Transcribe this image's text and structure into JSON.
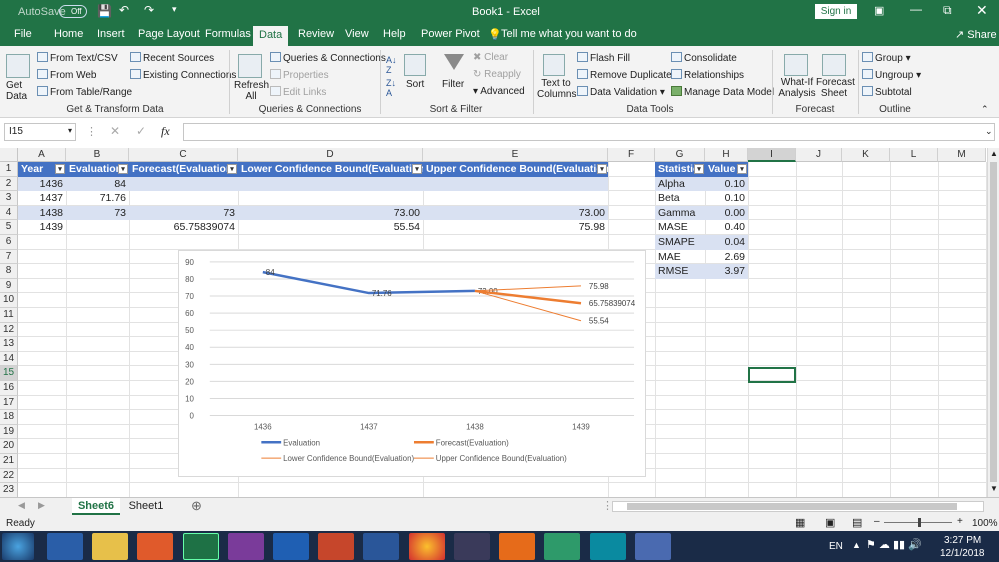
{
  "titlebar": {
    "autosave": "AutoSave",
    "autosave_state": "Off",
    "title": "Book1  -  Excel",
    "sign_in": "Sign in"
  },
  "ribbon_tabs": [
    "File",
    "Home",
    "Insert",
    "Page Layout",
    "Formulas",
    "Data",
    "Review",
    "View",
    "Help",
    "Power Pivot",
    "Tell me what you want to do"
  ],
  "share": "Share",
  "ribbon": {
    "get_data": "Get\nData",
    "from_text": "From Text/CSV",
    "from_web": "From Web",
    "from_table": "From Table/Range",
    "recent_sources": "Recent Sources",
    "existing_connections": "Existing Connections",
    "group_get_transform": "Get & Transform Data",
    "refresh_all": "Refresh All",
    "queries_connections": "Queries & Connections",
    "properties": "Properties",
    "edit_links": "Edit Links",
    "group_queries": "Queries & Connections",
    "sort": "Sort",
    "filter": "Filter",
    "clear": "Clear",
    "reapply": "Reapply",
    "advanced": "Advanced",
    "group_sort_filter": "Sort & Filter",
    "text_to_columns": "Text to Columns",
    "flash_fill": "Flash Fill",
    "remove_duplicates": "Remove Duplicates",
    "data_validation": "Data Validation",
    "consolidate": "Consolidate",
    "relationships": "Relationships",
    "manage_data_model": "Manage Data Model",
    "group_data_tools": "Data Tools",
    "what_if": "What-If Analysis",
    "forecast_sheet": "Forecast Sheet",
    "group_forecast": "Forecast",
    "group": "Group",
    "ungroup": "Ungroup",
    "subtotal": "Subtotal",
    "group_outline": "Outline"
  },
  "formula_bar": {
    "name_box": "I15",
    "fx": "fx",
    "value": ""
  },
  "columns": [
    "A",
    "B",
    "C",
    "D",
    "E",
    "F",
    "G",
    "H",
    "I",
    "J",
    "K",
    "L",
    "M"
  ],
  "rows": [
    "1",
    "2",
    "3",
    "4",
    "5",
    "6",
    "7",
    "8",
    "9",
    "10",
    "11",
    "12",
    "13",
    "14",
    "15",
    "16",
    "17",
    "18",
    "19",
    "20",
    "21",
    "22",
    "23"
  ],
  "table1": {
    "headers": [
      "Year",
      "Evaluation",
      "Forecast(Evaluation)",
      "Lower Confidence Bound(Evaluation)",
      "Upper Confidence Bound(Evaluation)"
    ],
    "rows": [
      [
        "1436",
        "84",
        "",
        "",
        ""
      ],
      [
        "1437",
        "71.76",
        "",
        "",
        ""
      ],
      [
        "1438",
        "73",
        "73",
        "73.00",
        "73.00"
      ],
      [
        "1439",
        "",
        "65.75839074",
        "55.54",
        "75.98"
      ]
    ]
  },
  "table2": {
    "headers": [
      "Statistic",
      "Value"
    ],
    "rows": [
      [
        "Alpha",
        "0.10"
      ],
      [
        "Beta",
        "0.10"
      ],
      [
        "Gamma",
        "0.00"
      ],
      [
        "MASE",
        "0.40"
      ],
      [
        "SMAPE",
        "0.04"
      ],
      [
        "MAE",
        "2.69"
      ],
      [
        "RMSE",
        "3.97"
      ]
    ]
  },
  "chart_data": {
    "type": "line",
    "categories": [
      "1436",
      "1437",
      "1438",
      "1439"
    ],
    "ylim": [
      0,
      90
    ],
    "yticks": [
      "0",
      "10",
      "20",
      "30",
      "40",
      "50",
      "60",
      "70",
      "80",
      "90"
    ],
    "series": [
      {
        "name": "Evaluation",
        "values": [
          84,
          71.76,
          73,
          null
        ],
        "color": "#4472c4",
        "labels": [
          "84",
          "71.76",
          "73.00",
          ""
        ]
      },
      {
        "name": "Forecast(Evaluation)",
        "values": [
          null,
          null,
          73,
          65.75839074
        ],
        "color": "#ed7d31",
        "labels": [
          "",
          "",
          "",
          "65.75839074"
        ]
      },
      {
        "name": "Lower Confidence Bound(Evaluation)",
        "values": [
          null,
          null,
          73,
          55.54
        ],
        "color": "#ed7d31",
        "labels": [
          "",
          "",
          "",
          "55.54"
        ]
      },
      {
        "name": "Upper Confidence Bound(Evaluation)",
        "values": [
          null,
          null,
          73,
          75.98
        ],
        "color": "#ed7d31",
        "labels": [
          "",
          "",
          "",
          "75.98"
        ]
      }
    ]
  },
  "sheets": {
    "active": "Sheet6",
    "other": "Sheet1"
  },
  "status": {
    "ready": "Ready",
    "zoom": "100%"
  },
  "taskbar": {
    "lang": "EN",
    "time": "3:27 PM",
    "date": "12/1/2018"
  }
}
